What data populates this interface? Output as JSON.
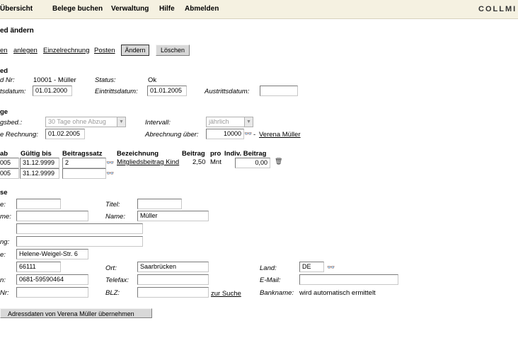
{
  "nav": {
    "items": [
      "Übersicht",
      "Belege buchen",
      "Verwaltung",
      "Hilfe",
      "Abmelden"
    ],
    "logo": "COLLMI"
  },
  "page_title": "ed ändern",
  "actions": {
    "link_0": "en",
    "link_anlegen": "anlegen",
    "link_einzelrechnung": "Einzelrechnung",
    "link_posten": "Posten",
    "btn_aendern": "Ändern",
    "btn_loeschen": "Löschen"
  },
  "member": {
    "section": "ed",
    "nr_label": "d Nr:",
    "nr_value": "10001 - Müller",
    "status_label": "Status:",
    "status_value": "Ok",
    "datum_label": "tsdatum:",
    "datum_value": "01.01.2000",
    "eintritt_label": "Eintrittsdatum:",
    "eintritt_value": "01.01.2005",
    "austritt_label": "Austrittsdatum:",
    "austritt_value": ""
  },
  "billing": {
    "section": "ge",
    "zahlung_label": "gsbed.:",
    "zahlung_value": "30 Tage ohne Abzug",
    "intervall_label": "Intervall:",
    "intervall_value": "jährlich",
    "rechnung_label": "e Rechnung:",
    "rechnung_value": "01.02.2005",
    "abrechnung_label": "Abrechnung über:",
    "abrechnung_value": "10000",
    "abrechnung_dash": "-",
    "abrechnung_name": "Verena Müller"
  },
  "contrib": {
    "headers": {
      "ab": "ab",
      "gueltig": "Gültig bis",
      "satz": "Beitragssatz",
      "bez": "Bezeichnung",
      "beitrag": "Beitrag",
      "pro": "pro",
      "indiv": "Indiv. Beitrag"
    },
    "rows": [
      {
        "ab": "005",
        "gueltig": "31.12.9999",
        "satz": "2",
        "bez": "Mitgliedsbeitrag Kind",
        "beitrag": "2,50",
        "pro": "Mnt",
        "indiv": "0,00"
      },
      {
        "ab": "005",
        "gueltig": "31.12.9999",
        "satz": "",
        "bez": "",
        "beitrag": "",
        "pro": "",
        "indiv": ""
      }
    ]
  },
  "address": {
    "section": "se",
    "anrede_label": "e:",
    "anrede_value": "",
    "titel_label": "Titel:",
    "titel_value": "",
    "vorname_label": "me:",
    "vorname_value": "",
    "name_label": "Name:",
    "name_value": "Müller",
    "zusatz_value": "",
    "zusatz2_label": "ng:",
    "zusatz2_value": "",
    "strasse_label": "e:",
    "strasse_value": "Helene-Weigel-Str. 6",
    "plz_value": "66111",
    "ort_label": "Ort:",
    "ort_value": "Saarbrücken",
    "land_label": "Land:",
    "land_value": "DE",
    "tel_label": "n:",
    "tel_value": "0681-59590464",
    "fax_label": "Telefax:",
    "fax_value": "",
    "email_label": "E-Mail:",
    "email_value": "",
    "konto_label": "Nr:",
    "konto_value": "",
    "blz_label": "BLZ:",
    "blz_value": "",
    "suche_link": "zur Suche",
    "bank_label": "Bankname:",
    "bank_value": "wird automatisch ermittelt",
    "copy_button": "Adressdaten von Verena Müller übernehmen"
  }
}
